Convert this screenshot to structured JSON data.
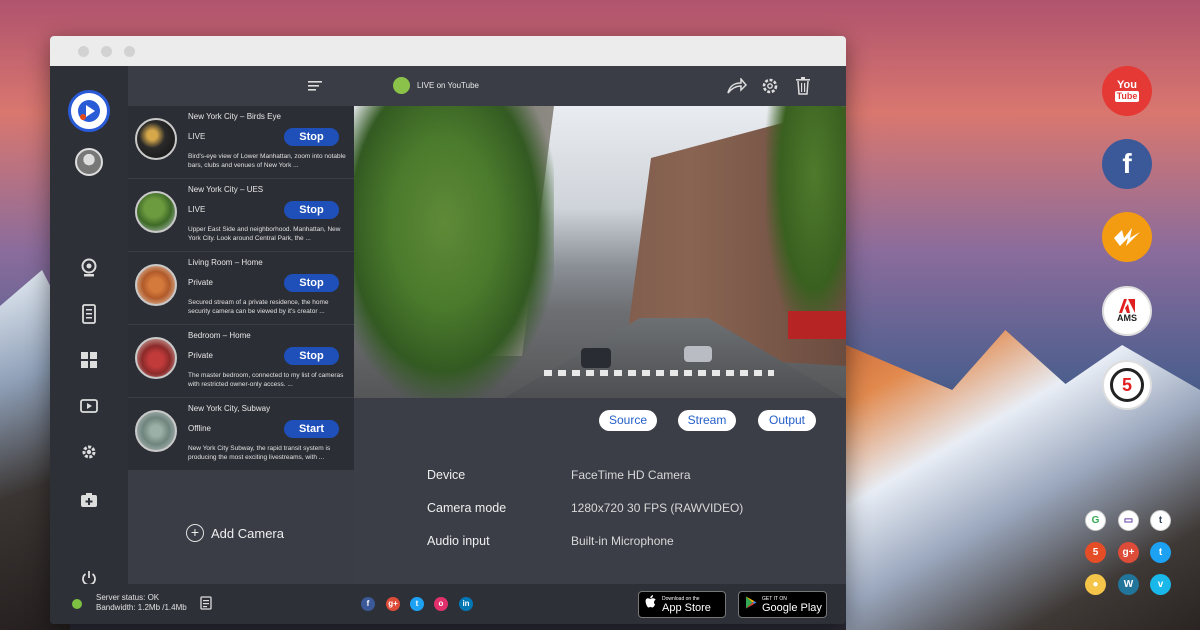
{
  "colors": {
    "accent_blue": "#1f4fb8",
    "live_green": "#8bc34a",
    "status_green": "#7cc142",
    "youtube_red": "#e53935",
    "facebook_blue": "#3b5998",
    "wowza_orange": "#f39c12"
  },
  "topbar": {
    "live_label": "LIVE on YouTube"
  },
  "cameras": [
    {
      "name": "New York City – Birds Eye",
      "status": "LIVE",
      "button": "Stop",
      "description": "Bird's-eye view of Lower Manhattan, zoom into notable bars, clubs and venues of New York ..."
    },
    {
      "name": "New York City – UES",
      "status": "LIVE",
      "button": "Stop",
      "description": "Upper East Side and neighborhood. Manhattan, New York City. Look around Central Park, the ..."
    },
    {
      "name": "Living Room – Home",
      "status": "Private",
      "button": "Stop",
      "description": "Secured stream of a private residence, the home security camera can be viewed by it's creator ..."
    },
    {
      "name": "Bedroom – Home",
      "status": "Private",
      "button": "Stop",
      "description": "The master bedroom, connected to my list of cameras with restricted owner-only access. ..."
    },
    {
      "name": "New York City, Subway",
      "status": "Offline",
      "button": "Start",
      "description": "New York City Subway, the rapid transit system is producing the most exciting livestreams, with ..."
    }
  ],
  "add_camera": "Add Camera",
  "tabs": [
    "Source",
    "Stream",
    "Output"
  ],
  "info": {
    "device_label": "Device",
    "device_value": "FaceTime HD Camera",
    "mode_label": "Camera mode",
    "mode_value": "1280x720 30 FPS (RAWVIDEO)",
    "audio_label": "Audio input",
    "audio_value": "Built-in Microphone"
  },
  "footer": {
    "server_status": "Server status: OK",
    "bandwidth": "Bandwidth: 1.2Mb /1.4Mb",
    "appstore_small": "Download on the",
    "appstore_big": "App Store",
    "googleplay_small": "GET IT ON",
    "googleplay_big": "Google Play"
  },
  "desktop_icons": {
    "youtube_top": "You",
    "youtube_bottom": "Tube",
    "ams": "AMS",
    "five": "5"
  },
  "icons": [
    "logo-icon",
    "avatar",
    "webcam-icon",
    "device-icon",
    "grid-icon",
    "video-icon",
    "settings-icon",
    "add-camera-icon",
    "power-icon",
    "filter-icon",
    "share-icon",
    "trash-icon"
  ]
}
